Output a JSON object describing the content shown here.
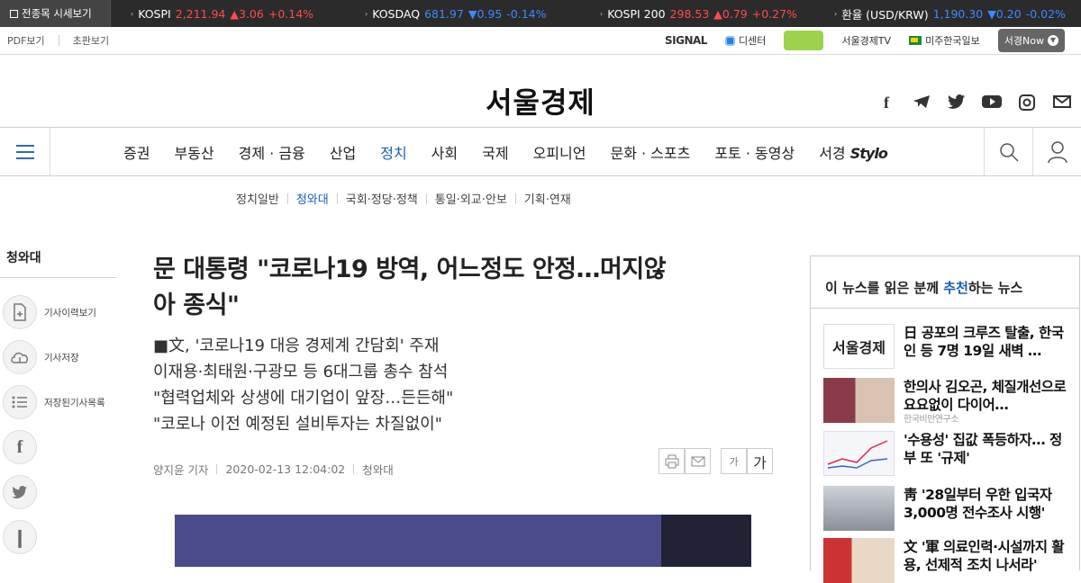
{
  "ticker": {
    "button": "전종목 시세보기",
    "items": [
      {
        "name": "KOSPI",
        "value": "2,211.94",
        "change": "▲3.06",
        "pct": "+0.14%",
        "dir": "up"
      },
      {
        "name": "KOSDAQ",
        "value": "681.97",
        "change": "▼0.95",
        "pct": "-0.14%",
        "dir": "down"
      },
      {
        "name": "KOSPI 200",
        "value": "298.53",
        "change": "▲0.79",
        "pct": "+0.27%",
        "dir": "up"
      },
      {
        "name": "환율 (USD/KRW)",
        "value": "1,190.30",
        "change": "▼0.20",
        "pct": "-0.02%",
        "dir": "down"
      }
    ]
  },
  "util": {
    "left": [
      "PDF보기",
      "초판보기"
    ],
    "signal": "SIGNAL",
    "decenter": "디센터",
    "game": "",
    "tv": "서울경제TV",
    "usa": "미주한국일보",
    "now": "서경Now"
  },
  "brand": {
    "logo": "서울경제"
  },
  "social": [
    "f",
    "telegram",
    "twitter",
    "youtube",
    "instagram",
    "mail"
  ],
  "menu": [
    "증권",
    "부동산",
    "경제 · 금융",
    "산업",
    "정치",
    "사회",
    "국제",
    "오피니언",
    "문화 · 스포츠",
    "포토 · 동영상",
    "서경"
  ],
  "menu_active_index": 4,
  "menu_logo": "Stylo",
  "submenu": [
    "정치일반",
    "청와대",
    "국회·정당·정책",
    "통일·외교·안보",
    "기획·연재"
  ],
  "submenu_active_index": 1,
  "left_side": {
    "title": "청와대",
    "buttons": [
      "기사이력보기",
      "기사저장",
      "저장된기사목록"
    ]
  },
  "article": {
    "headline_1": "문 대통령 \"코로나19 방역, 어느정도 안정…머지않",
    "headline_2": "아 종식\"",
    "subs": [
      "■文, '코로나19 대응 경제계 간담회' 주재",
      "이재용·최태원·구광모 등 6대그룹 총수 참석",
      "\"협력업체와 상생에 대기업이 앞장…든든해\"",
      "\"코로나 이전 예정된 설비투자는 차질없이\""
    ],
    "reporter": "양지윤 기자",
    "datetime": "2020-02-13 12:04:02",
    "section": "청와대",
    "font_small": "가",
    "font_large": "가"
  },
  "right": {
    "title_pre": "이 뉴스를 읽은 분께 ",
    "title_em": "추천",
    "title_post": "하는 뉴스",
    "items": [
      {
        "thumb": "서울경제",
        "text": "日 공포의 크루즈 탈출, 한국인 등 7명 19일 새벽 …"
      },
      {
        "thumb": "",
        "text": "한의사 김오곤, 체질개선으로 요요없이 다이어…",
        "overlay": "한국비만연구소"
      },
      {
        "thumb": "",
        "text": "'수용성' 집값 폭등하자… 정부 또 '규제'"
      },
      {
        "thumb": "",
        "text": "靑 '28일부터 우한 입국자 3,000명 전수조사 시행'"
      },
      {
        "thumb": "",
        "text": "文 '軍 의료인력·시설까지 활용, 선제적 조치 나서라'"
      }
    ]
  }
}
